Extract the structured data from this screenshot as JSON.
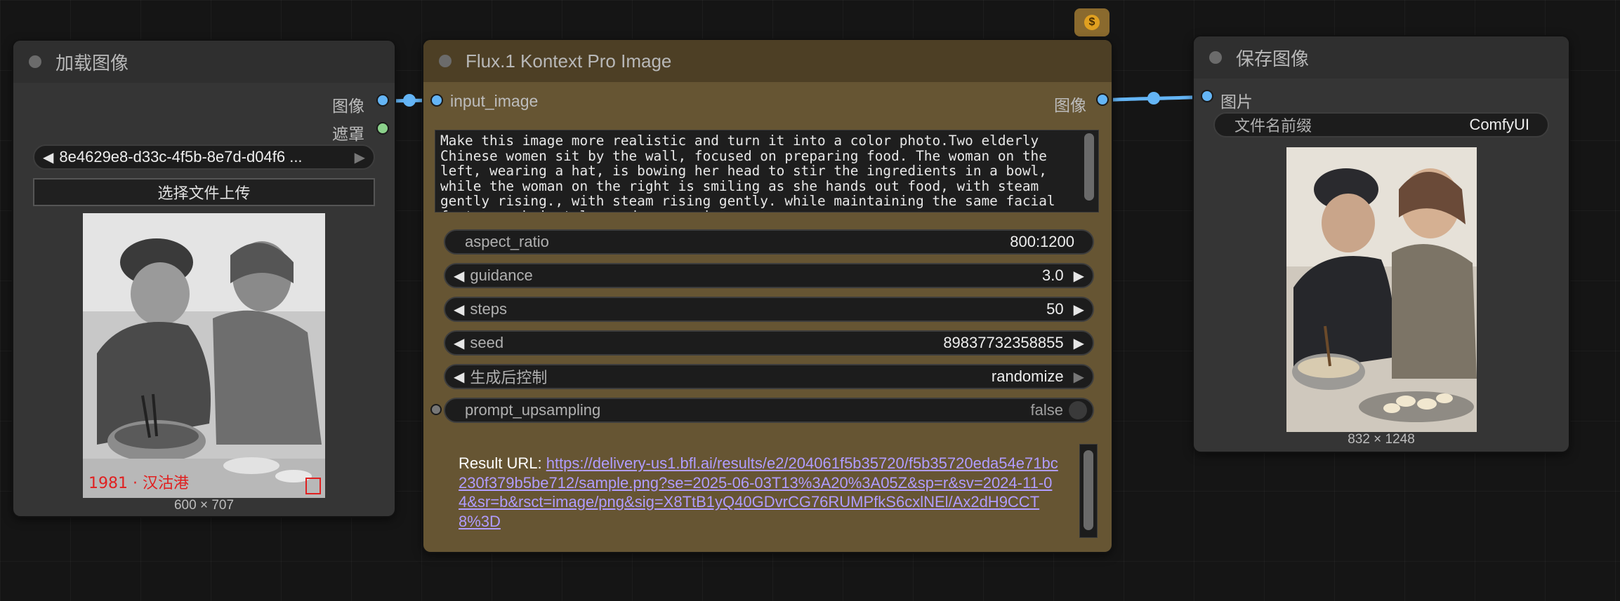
{
  "load_node": {
    "title": "加载图像",
    "outputs": [
      "图像",
      "遮罩"
    ],
    "file_value": "8e4629e8-d33c-4f5b-8e7d-d04f6 ...",
    "upload_label": "选择文件上传",
    "image_caption": "600 × 707",
    "stamp_text": "1981 · 汉沽港"
  },
  "flux_node": {
    "title": "Flux.1 Kontext Pro Image",
    "input_label": "input_image",
    "output_label": "图像",
    "prompt": "Make this image more realistic and turn it into a color photo.Two elderly Chinese women sit by the wall, focused on preparing food. The woman on the left, wearing a hat, is bowing her head to stir the ingredients in a bowl, while the woman on the right is smiling as she hands out food, with steam gently rising., with steam rising gently. while maintaining the same facial features, hairstyle, and expression",
    "widgets": {
      "aspect_ratio": {
        "name": "aspect_ratio",
        "value": "800:1200"
      },
      "guidance": {
        "name": "guidance",
        "value": "3.0"
      },
      "steps": {
        "name": "steps",
        "value": "50"
      },
      "seed": {
        "name": "seed",
        "value": "89837732358855"
      },
      "control": {
        "name": "生成后控制",
        "value": "randomize"
      },
      "upsampling": {
        "name": "prompt_upsampling",
        "value": "false"
      }
    },
    "result_label": "Result URL:",
    "result_url": "https://delivery-us1.bfl.ai/results/e2/204061f5b35720/f5b35720eda54e71bc230f379b5be712/sample.png?se=2025-06-03T13%3A20%3A05Z&sp=r&sv=2024-11-04&sr=b&rsct=image/png&sig=X8TtB1yQ40GDvrCG76RUMPfkS6cxlNEl/Ax2dH9CCT8%3D",
    "badge_icon": "dollar-icon",
    "badge_symbol": "$"
  },
  "save_node": {
    "title": "保存图像",
    "input_label": "图片",
    "prefix_name": "文件名前缀",
    "prefix_value": "ComfyUI",
    "image_caption": "832 × 1248"
  },
  "colors": {
    "canvas": "#151515",
    "node_body": "#353535",
    "flux_body": "#665533",
    "flux_title": "#4d3f25",
    "link_blue": "#64b5f6",
    "mask_green": "#8bd18b",
    "url_purple": "#b09cff"
  }
}
